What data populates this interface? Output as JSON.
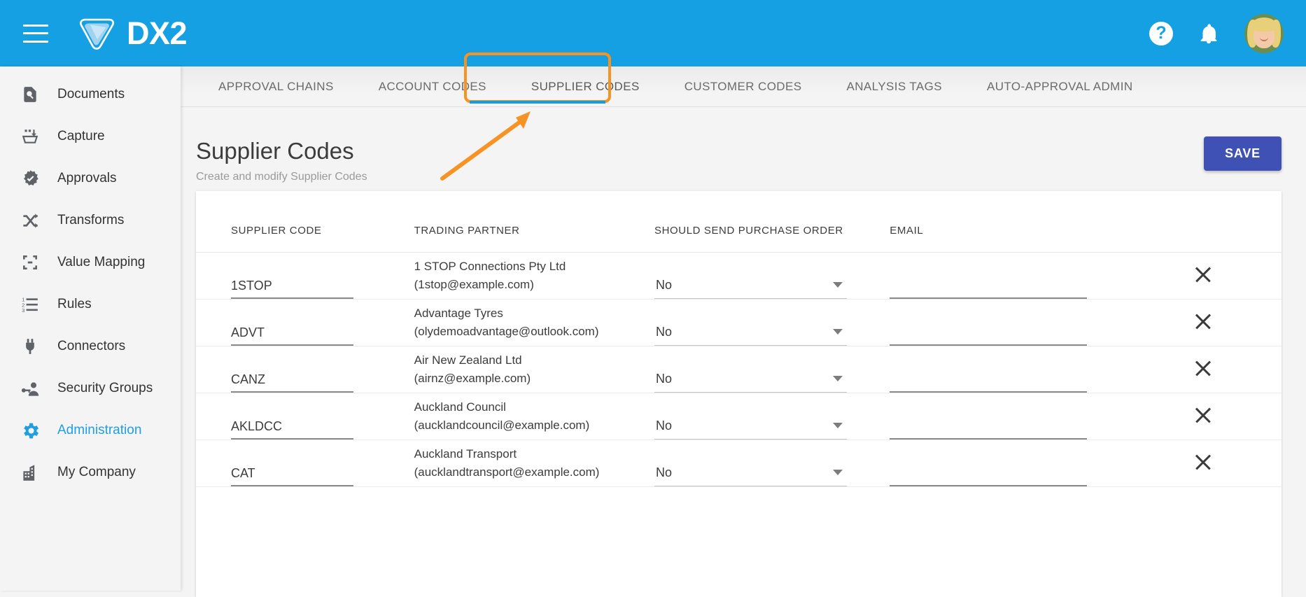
{
  "app": {
    "brand": "DX2",
    "menu_icon": "hamburger-icon",
    "help_icon": "?",
    "bell_icon": "notifications-icon",
    "avatar_icon": "user-avatar"
  },
  "sidebar": {
    "items": [
      {
        "label": "Documents",
        "icon": "document-search-icon",
        "active": false
      },
      {
        "label": "Capture",
        "icon": "capture-icon",
        "active": false
      },
      {
        "label": "Approvals",
        "icon": "approvals-badge-icon",
        "active": false
      },
      {
        "label": "Transforms",
        "icon": "transforms-icon",
        "active": false
      },
      {
        "label": "Value Mapping",
        "icon": "value-mapping-icon",
        "active": false
      },
      {
        "label": "Rules",
        "icon": "rules-list-icon",
        "active": false
      },
      {
        "label": "Connectors",
        "icon": "connector-plug-icon",
        "active": false
      },
      {
        "label": "Security Groups",
        "icon": "security-groups-icon",
        "active": false
      },
      {
        "label": "Administration",
        "icon": "gear-icon",
        "active": true
      },
      {
        "label": "My Company",
        "icon": "building-icon",
        "active": false
      }
    ]
  },
  "tabs": [
    {
      "label": "APPROVAL CHAINS",
      "selected": false
    },
    {
      "label": "ACCOUNT CODES",
      "selected": false
    },
    {
      "label": "SUPPLIER CODES",
      "selected": true
    },
    {
      "label": "CUSTOMER CODES",
      "selected": false
    },
    {
      "label": "ANALYSIS TAGS",
      "selected": false
    },
    {
      "label": "AUTO-APPROVAL ADMIN",
      "selected": false
    }
  ],
  "page": {
    "title": "Supplier Codes",
    "subtitle": "Create and modify Supplier Codes",
    "save_label": "SAVE"
  },
  "table": {
    "headers": [
      "SUPPLIER CODE",
      "TRADING PARTNER",
      "SHOULD SEND PURCHASE ORDER",
      "EMAIL",
      ""
    ],
    "rows": [
      {
        "code": "1STOP",
        "partner_name": "1 STOP Connections Pty Ltd",
        "partner_email": "(1stop@example.com)",
        "send_po": "No",
        "email": ""
      },
      {
        "code": "ADVT",
        "partner_name": "Advantage Tyres",
        "partner_email": "(olydemoadvantage@outlook.com)",
        "send_po": "No",
        "email": ""
      },
      {
        "code": "CANZ",
        "partner_name": "Air New Zealand Ltd",
        "partner_email": "(airnz@example.com)",
        "send_po": "No",
        "email": ""
      },
      {
        "code": "AKLDCC",
        "partner_name": "Auckland Council",
        "partner_email": "(aucklandcouncil@example.com)",
        "send_po": "No",
        "email": ""
      },
      {
        "code": "CAT",
        "partner_name": "Auckland Transport",
        "partner_email": "(aucklandtransport@example.com)",
        "send_po": "No",
        "email": ""
      }
    ],
    "delete_icon": "close-icon",
    "dropdown_icon": "chevron-down-icon"
  },
  "annotation": {
    "highlight_target": "SUPPLIER CODES",
    "highlight_color": "#f79324",
    "arrow": "pointer-arrow"
  },
  "colors": {
    "brand_blue": "#14a0e2",
    "accent_blue": "#1f9fe0",
    "save_button": "#3f51b5",
    "annotation_orange": "#f79324",
    "page_bg": "#f4f4f4"
  }
}
